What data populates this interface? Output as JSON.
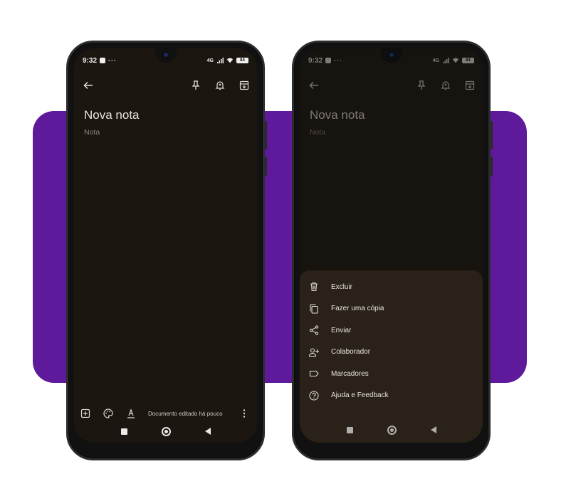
{
  "status": {
    "time": "9:32",
    "signal": "4G",
    "battery": "84"
  },
  "note": {
    "title": "Nova nota",
    "body": "Nota"
  },
  "bottom": {
    "edited": "Documento editado há pouco"
  },
  "menu": {
    "items": [
      {
        "label": "Excluir",
        "icon": "trash-icon"
      },
      {
        "label": "Fazer uma cópia",
        "icon": "copy-icon"
      },
      {
        "label": "Enviar",
        "icon": "share-icon"
      },
      {
        "label": "Colaborador",
        "icon": "add-person-icon"
      },
      {
        "label": "Marcadores",
        "icon": "label-icon"
      },
      {
        "label": "Ajuda e Feedback",
        "icon": "help-icon"
      }
    ]
  },
  "colors": {
    "band": "#5e1a9b",
    "screen": "#1b1610",
    "sheet": "#2a2219"
  }
}
